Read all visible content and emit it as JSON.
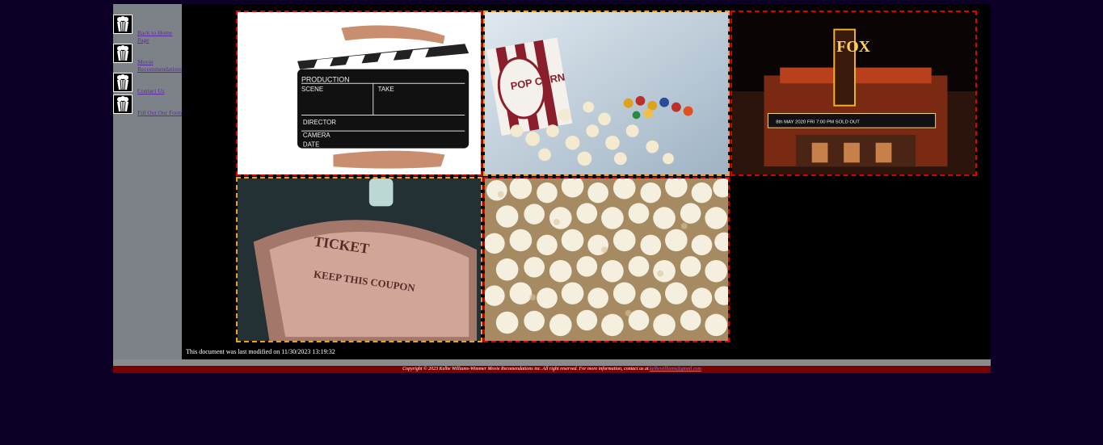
{
  "nav": {
    "items": [
      {
        "label": "Back to Home Page",
        "icon": "popcorn-icon"
      },
      {
        "label": "Movie Recommendations",
        "icon": "popcorn-icon"
      },
      {
        "label": "Contact Us",
        "icon": "popcorn-icon"
      },
      {
        "label": "Fill Out Our Form",
        "icon": "popcorn-icon"
      }
    ]
  },
  "gallery": {
    "tiles": [
      {
        "name": "clapperboard-image",
        "border": "red",
        "clap_labels": [
          "PRODUCTION",
          "SCENE",
          "TAKE",
          "DIRECTOR",
          "CAMERA",
          "DATE"
        ]
      },
      {
        "name": "popcorn-candy-image",
        "border": "orange",
        "box_text": "POP CORN"
      },
      {
        "name": "fox-theater-image",
        "border": "red",
        "sign_text": "FOX",
        "marquee": "8th MAY 2020 FRI 7:00 PM  SOLD OUT"
      },
      {
        "name": "movie-tickets-image",
        "border": "orange",
        "ticket_words": [
          "TICKET",
          "KEEP THIS COUPON"
        ]
      },
      {
        "name": "popcorn-closeup-image",
        "border": "red"
      }
    ]
  },
  "modified_text": "This document was last modified on 11/30/2023 13:19:32",
  "footer": {
    "text": "Copyright © 2023 Kelbe Williams-Wimmer Movie Recomendations inc. All right reserved. For more information, contact us at ",
    "email": "kelbewilliams@gmail.com"
  },
  "colors": {
    "page_bg": "#0c0026",
    "sidebar_bg": "#7d8288",
    "footer_bg": "#7a0000",
    "border_red": "#e00000",
    "border_orange": "#f0a020"
  }
}
